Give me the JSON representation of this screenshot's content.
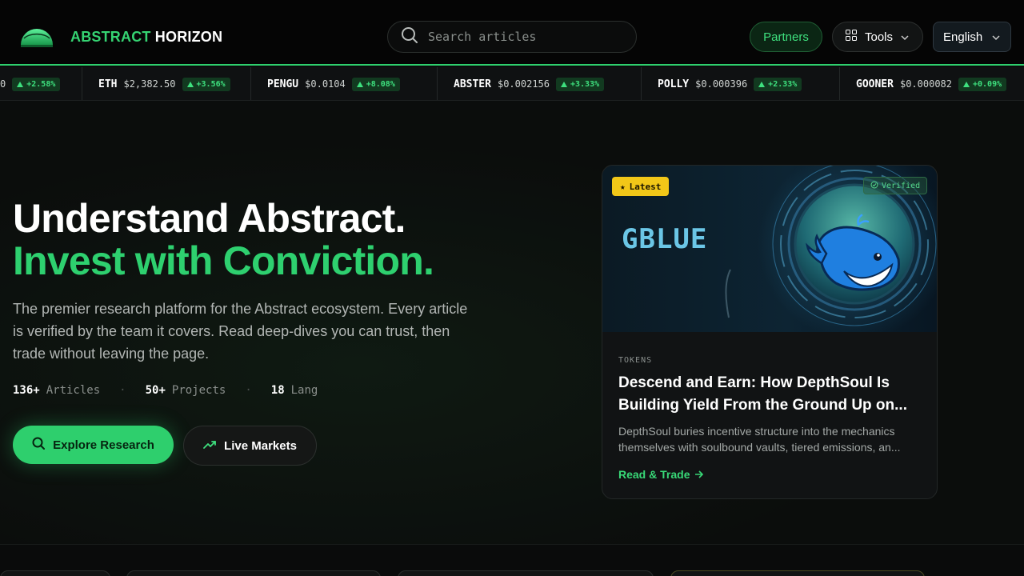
{
  "header": {
    "brand_part1": "ABSTRACT",
    "brand_part2": "HORIZON",
    "search_placeholder": "Search articles",
    "partners_label": "Partners",
    "tools_label": "Tools",
    "language_label": "English"
  },
  "ticker": [
    {
      "symbol": "",
      "price": "0",
      "change": "+2.58%"
    },
    {
      "symbol": "ETH",
      "price": "$2,382.50",
      "change": "+3.56%"
    },
    {
      "symbol": "PENGU",
      "price": "$0.0104",
      "change": "+8.08%"
    },
    {
      "symbol": "ABSTER",
      "price": "$0.002156",
      "change": "+3.33%"
    },
    {
      "symbol": "POLLY",
      "price": "$0.000396",
      "change": "+2.33%"
    },
    {
      "symbol": "GOONER",
      "price": "$0.000082",
      "change": "+0.09%"
    }
  ],
  "hero": {
    "headline_line1": "Understand Abstract.",
    "headline_line2": "Invest with Conviction.",
    "description": "The premier research platform for the Abstract ecosystem. Every article is verified by the team it covers. Read deep-dives you can trust, then trade without leaving the page.",
    "stats": [
      {
        "value": "136+",
        "label": "Articles"
      },
      {
        "value": "50+",
        "label": "Projects"
      },
      {
        "value": "18",
        "label": "Lang"
      }
    ],
    "primary_cta": "Explore Research",
    "secondary_cta": "Live Markets"
  },
  "featured": {
    "badge": "Latest",
    "verified": "Verified",
    "image_text": "GBLUE",
    "category": "TOKENS",
    "title": "Descend and Earn: How DepthSoul Is Building Yield From the Ground Up on...",
    "description": "DepthSoul buries incentive structure into the mechanics themselves with soulbound vaults, tiered emissions, an...",
    "link": "Read & Trade"
  },
  "colors": {
    "accent": "#2ecf6d",
    "badge_yellow": "#f2c718",
    "background": "#0b0d0c"
  }
}
